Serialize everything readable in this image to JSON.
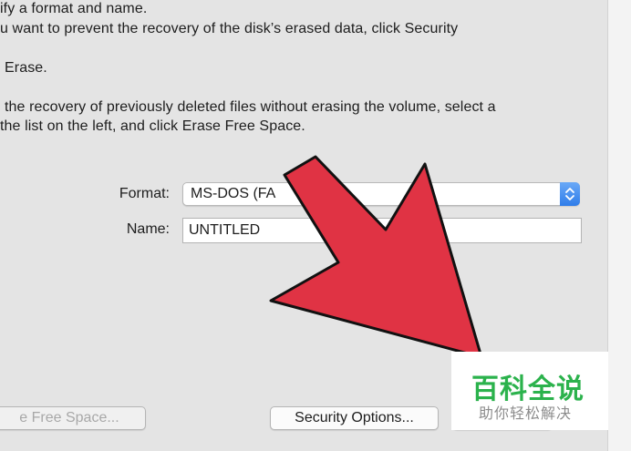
{
  "instructions": {
    "line1": "ify a format and name.",
    "line2": "u want to prevent the recovery of the disk’s erased data, click Security",
    "line3": "Erase.",
    "line4": "the recovery of previously deleted files without erasing the volume, select a",
    "line5": "the list on the left, and click Erase Free Space."
  },
  "form": {
    "format_label": "Format:",
    "format_value": "MS-DOS (FA",
    "name_label": "Name:",
    "name_value": "UNTITLED"
  },
  "buttons": {
    "erase_free_space": "e Free Space...",
    "security_options": "Security Options..."
  },
  "overlay": {
    "arrow_color": "#e03344"
  },
  "watermark": {
    "title": "百科全说",
    "subtitle": "助你轻松解决"
  }
}
